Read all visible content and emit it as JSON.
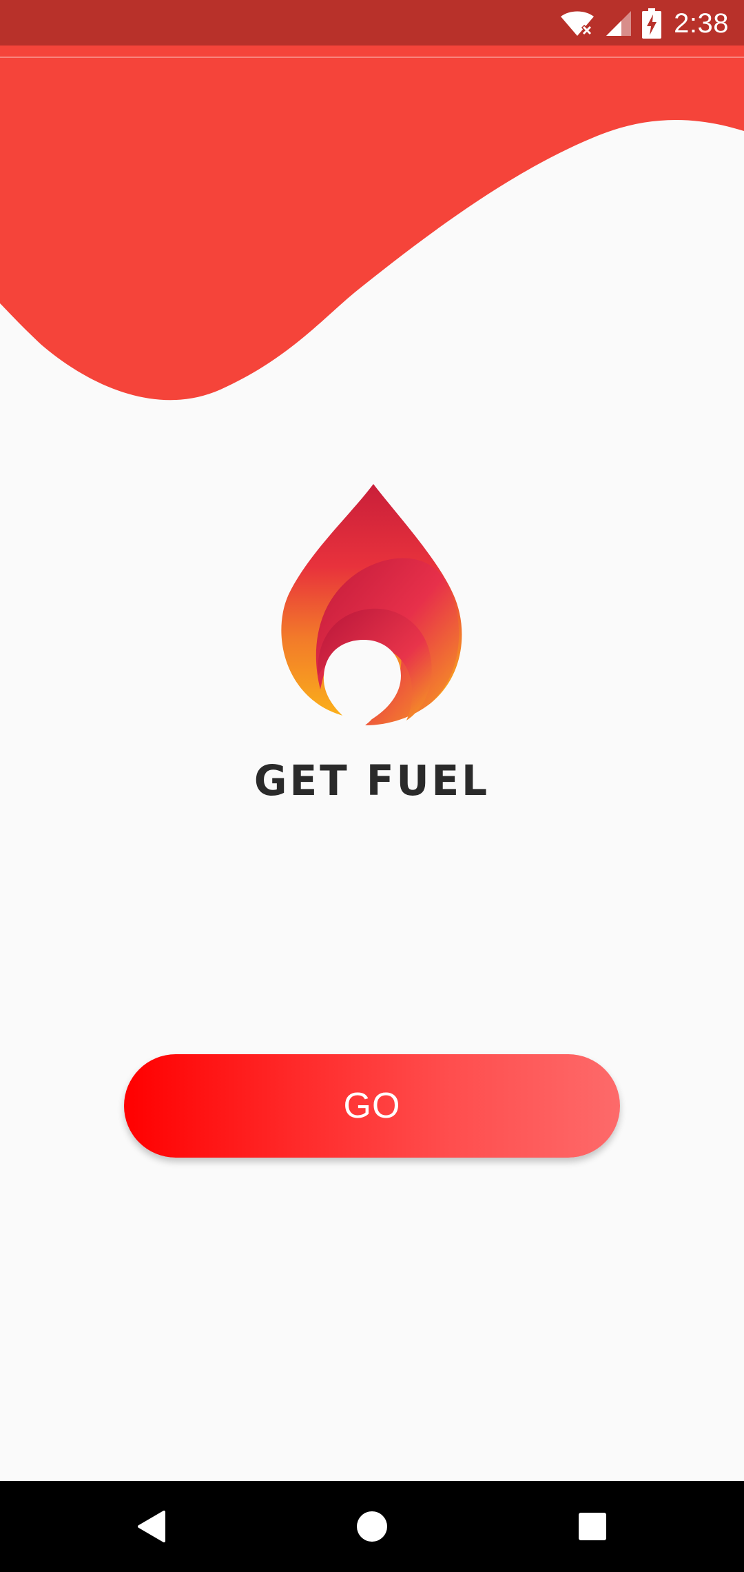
{
  "status_bar": {
    "time": "2:38",
    "icons": [
      "wifi-off-icon",
      "cellular-signal-icon",
      "battery-charging-icon"
    ]
  },
  "colors": {
    "status_bar": "#b8312a",
    "wave": "#f5443a",
    "background": "#fafafa",
    "button_start": "#ff0000",
    "button_end": "#fd6a6a"
  },
  "logo": {
    "icon": "flame-drop-logo-icon",
    "text": "GET FUEL"
  },
  "main": {
    "go_label": "GO"
  },
  "navigation": {
    "buttons": [
      "back-icon",
      "home-icon",
      "recents-icon"
    ]
  }
}
